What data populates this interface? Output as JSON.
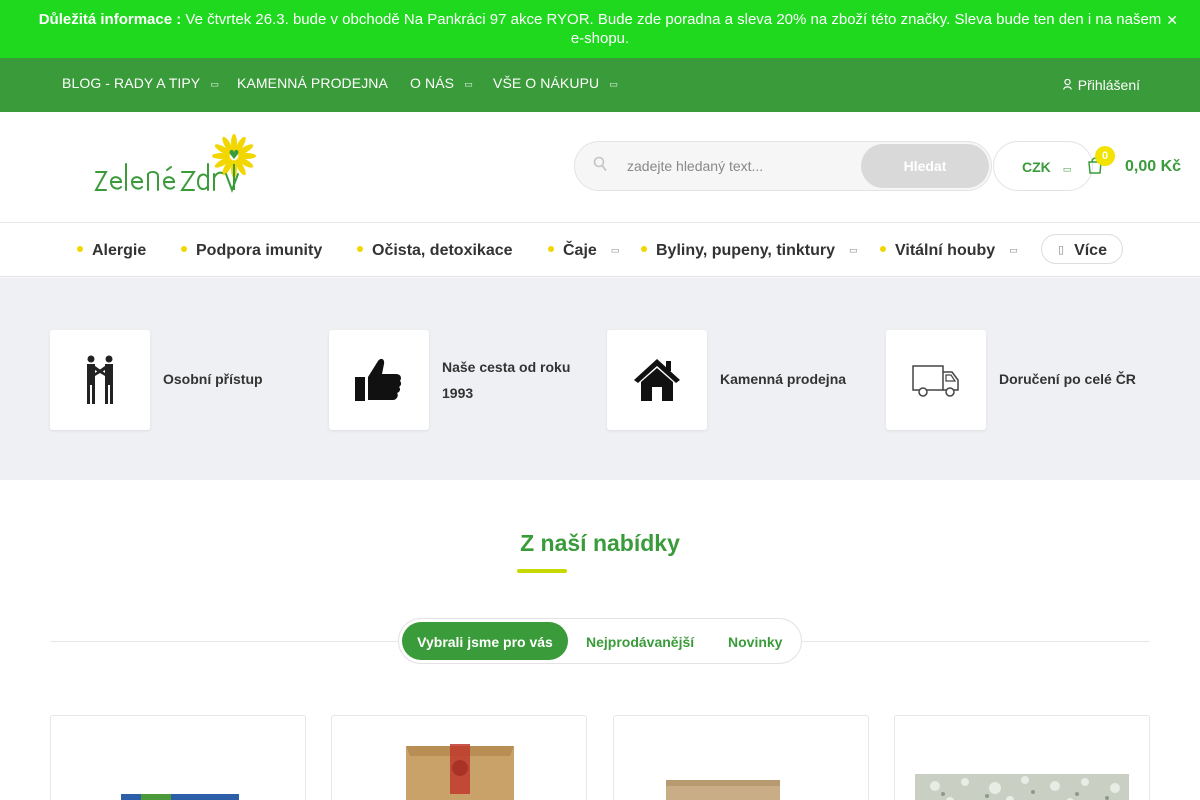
{
  "notice": {
    "label": "Důležitá informace :",
    "text": " Ve čtvrtek 26.3. bude v obchodě Na Pankráci 97 akce RYOR. Bude zde poradna a sleva 20% na zboží této značky. Sleva bude ten den i na našem e-shopu.",
    "close_glyph": "✕"
  },
  "topnav": {
    "items": [
      {
        "label": "BLOG - RADY A TIPY"
      },
      {
        "label": "KAMENNÁ PRODEJNA"
      },
      {
        "label": "O NÁS"
      },
      {
        "label": "VŠE O NÁKUPU"
      }
    ],
    "login": "Přihlášení"
  },
  "search": {
    "placeholder": "zadejte hledaný text...",
    "button": "Hledat"
  },
  "currency": "CZK",
  "cart": {
    "count": "0",
    "total": "0,00 Kč"
  },
  "categories": [
    {
      "label": "Alergie"
    },
    {
      "label": "Podpora imunity"
    },
    {
      "label": "Očista, detoxikace"
    },
    {
      "label": "Čaje"
    },
    {
      "label": "Byliny, pupeny, tinktury"
    },
    {
      "label": "Vitální houby"
    }
  ],
  "more": "Více",
  "benefits": [
    {
      "label": "Osobní přístup",
      "icon": "handshake-people-icon"
    },
    {
      "label": "Naše cesta od roku 1993",
      "icon": "thumbs-up-icon"
    },
    {
      "label": "Kamenná prodejna",
      "icon": "house-icon"
    },
    {
      "label": "Doručení po celé ČR",
      "icon": "delivery-truck-icon"
    }
  ],
  "section": {
    "title": "Z naší nabídky",
    "tabs": [
      {
        "label": "Vybrali jsme pro vás",
        "active": true
      },
      {
        "label": "Nejprodávanější",
        "active": false
      },
      {
        "label": "Novinky",
        "active": false
      }
    ]
  },
  "colors": {
    "notice_bg": "#1ed91e",
    "nav_bg": "#3a9b3a",
    "accent_yellow": "#f2d600",
    "benefits_bg": "#eef0f3"
  }
}
